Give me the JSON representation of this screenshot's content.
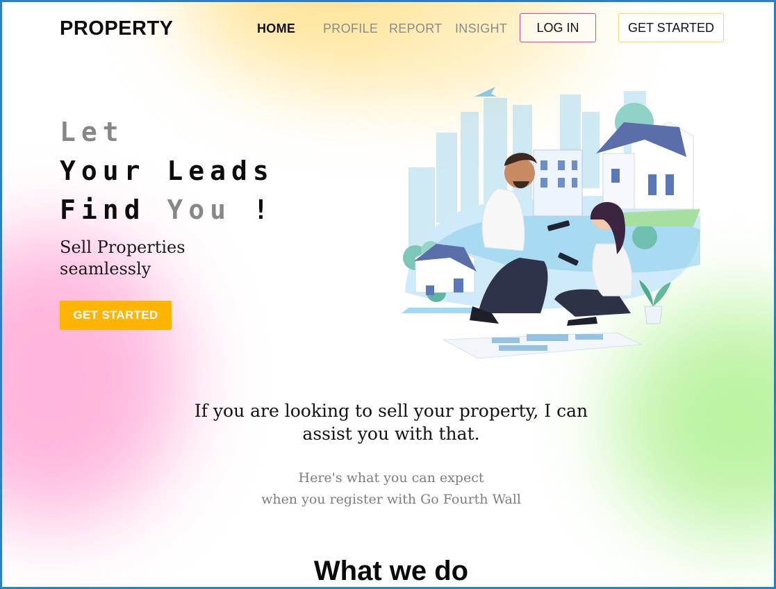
{
  "nav": {
    "logo": "PROPERTY",
    "home": "HOME",
    "profile": "PROFILE",
    "report": "REPORT",
    "insight": "INSIGHT",
    "login": "LOG IN",
    "get_started": "GET STARTED"
  },
  "hero": {
    "line1": "Let",
    "line2": "Your Leads",
    "line3_a": "Find",
    "line3_b": "You",
    "line3_c": "!",
    "sub_line1": "Sell Properties",
    "sub_line2": "seamlessly",
    "cta": "GET STARTED"
  },
  "intro": {
    "statement_line1": "If you are looking to sell your property, I can",
    "statement_line2": "assist you with that.",
    "expect_line1": "Here's what you can expect",
    "expect_line2": "when you register with Go Fourth Wall"
  },
  "section": {
    "title": "What we do"
  },
  "colors": {
    "accent_yellow": "#ffb400",
    "login_border": "#e4419a",
    "start_border": "#f1d76d",
    "frame_border": "#2b7fc4"
  }
}
